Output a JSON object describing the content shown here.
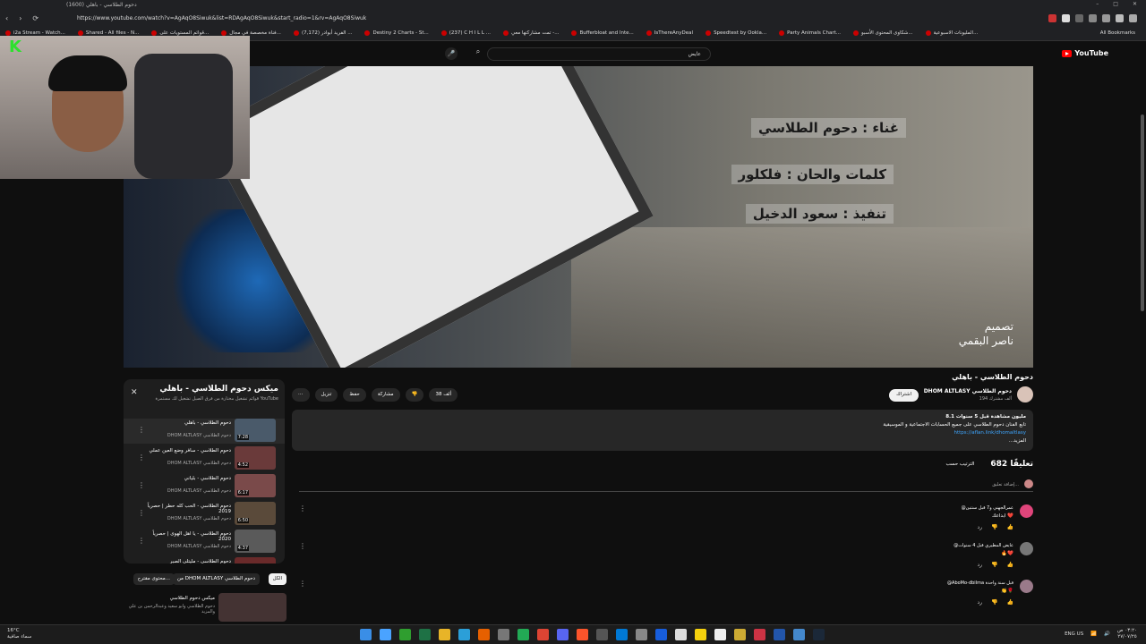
{
  "browser": {
    "tab_title": "(1600) دحوم الطلاسي - باهلي",
    "url": "https://www.youtube.com/watch?v=AgAqO8Siwuk&list=RDAgAqO8Siwuk&start_radio=1&rv=AgAqO8Siwuk",
    "nav": {
      "back": "‹",
      "forward": "›",
      "reload": "⟳"
    },
    "window": {
      "minimize": "–",
      "maximize": "□",
      "close": "✕"
    },
    "all_bookmarks": "All Bookmarks",
    "bookmarks": [
      {
        "label": "i2a Stream - Watch..."
      },
      {
        "label": "Shared - All files - N..."
      },
      {
        "label": "قوائم المستويات على..."
      },
      {
        "label": "فناة مخصصة في مجال..."
      },
      {
        "label": "(7,172) الفريد أبوادر ..."
      },
      {
        "label": "Destiny 2 Charts - St..."
      },
      {
        "label": "(237) C H I L L ..."
      },
      {
        "label": "تمت مشاركتها معي -..."
      },
      {
        "label": "Bufferbloat and Inte..."
      },
      {
        "label": "IsThereAnyDeal"
      },
      {
        "label": "Speedtest by Ookla..."
      },
      {
        "label": "Party Animals Chart..."
      },
      {
        "label": "شكاوى المحتوى الأسبو..."
      },
      {
        "label": "المليونات الاسبوعية..."
      }
    ]
  },
  "youtube": {
    "logo_text": "YouTube",
    "search_value": "عايض",
    "search_icon": "⌕",
    "clear_icon": "✕",
    "mic_icon": "🎤"
  },
  "video": {
    "credits": [
      "غناء : دحوم الطلاسي",
      "كلمات والحان : فلكلور",
      "تنفيذ : سعود الدخيل"
    ],
    "designer_label": "تصميم",
    "designer_name": "ناصر البقمي"
  },
  "webcam": {
    "logo": "K"
  },
  "playlist": {
    "title": "ميكس دحوم الطلاسي - باهلي",
    "subtitle": "قوائم تشغيل مختارة من فرق الصيل تشغيل لك مستمرة YouTube",
    "close_icon": "✕",
    "items": [
      {
        "title": "دحوم الطلاسي - باهلي",
        "channel": "DHOM ALTLASY دحوم الطلاسي",
        "duration": "7:28"
      },
      {
        "title": "دحوم الطلاسي - سافر وضع العين عملي",
        "channel": "DHOM ALTLASY دحوم الطلاسي",
        "duration": "4:52"
      },
      {
        "title": "دحوم الطلاسي - بلياني",
        "channel": "DHOM ALTLASY دحوم الطلاسي",
        "duration": "6:17"
      },
      {
        "title": "دحوم الطلاسي - الحب كله حطر | حصرياً 2019",
        "channel": "DHOM ALTLASY دحوم الطلاسي",
        "duration": "6:50"
      },
      {
        "title": "دحوم الطلاسي - يا اهل الهوى | حصرياً 2020",
        "channel": "DHOM ALTLASY دحوم الطلاسي",
        "duration": "4:37"
      },
      {
        "title": "دحوم الطلاسي - مليتلي الصبر",
        "channel": "",
        "duration": ""
      }
    ]
  },
  "chips": {
    "all": "الكل",
    "from_channel": "من DHOM ALTLASY دحوم الطلاسي",
    "related": "محتوى مقترح..."
  },
  "related": {
    "title": "ميكس دحوم الطلاسي",
    "subtitle": "دحوم الطلاسي وابو سعيد وعبدالرحمن بن علي والمزيد"
  },
  "meta": {
    "title": "دحوم الطلاسي - باهلي",
    "channel": "DHOM ALTLASY دحوم الطلاسي",
    "subs": "194 ألف مشترك",
    "subscribe": "اشتراك",
    "likes": "38 ألف",
    "share": "مشاركة",
    "download": "تنزيل",
    "save": "حفظ",
    "more": "⋯"
  },
  "description": {
    "stats": "8.1 مليون مشاهدة قبل 5 سنوات",
    "line1": "تابع الفنان دحوم الطلاسي على جميع الحسابات الاجتماعية و الموسيقية",
    "link": "https://aflan.link/dhomaltlasy",
    "more": "...المزيد"
  },
  "comments": {
    "count": "682 تعليقًا",
    "sort": "الترتيب حسب",
    "add_placeholder": "إضافة تعليق...",
    "items": [
      {
        "author": "@عمرالجهني و7 قبل سنتين",
        "text": "ابداعك ❤️",
        "avatar_color": "#e0457b"
      },
      {
        "author": "@عايض المطيري قبل 4 سنوات",
        "text": "🔥❤️",
        "avatar_color": "#777777"
      },
      {
        "author": "@AboMo-dbilma قبل سنة واحدة",
        "text": "👏🌹",
        "avatar_color": "#9a7a8a"
      }
    ],
    "reply": "رد"
  },
  "taskbar": {
    "temp": "16°C",
    "weather": "سماء صافية",
    "lang": "ENG US",
    "time": "٠٣:٢٠ ص",
    "date": "٢٧/٠٧/٢٥"
  }
}
